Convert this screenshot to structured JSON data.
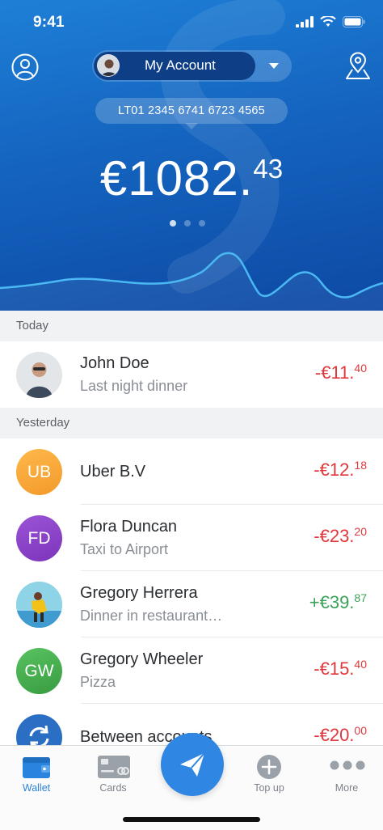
{
  "status_bar": {
    "time": "9:41"
  },
  "header": {
    "account_label": "My Account",
    "iban": "LT01 2345 6741 6723 4565",
    "balance_main": "€1082.",
    "balance_cents": "43"
  },
  "sections": [
    {
      "title": "Today"
    },
    {
      "title": "Yesterday"
    }
  ],
  "transactions": [
    {
      "name": "John Doe",
      "description": "Last night dinner",
      "amount_main": "-€11.",
      "amount_cents": "40",
      "initials": "",
      "avatar": "photo-man-glasses"
    },
    {
      "name": "Uber B.V",
      "description": "",
      "amount_main": "-€12.",
      "amount_cents": "18",
      "initials": "UB",
      "avatar_color": "#f5a33a"
    },
    {
      "name": "Flora Duncan",
      "description": "Taxi to Airport",
      "amount_main": "-€23.",
      "amount_cents": "20",
      "initials": "FD",
      "avatar_color": "#8d3fc9"
    },
    {
      "name": "Gregory Herrera",
      "description": "Dinner in restaurant…",
      "amount_main": "+€39.",
      "amount_cents": "87",
      "initials": "",
      "avatar": "photo-person-yellow"
    },
    {
      "name": "Gregory Wheeler",
      "description": "Pizza",
      "amount_main": "-€15.",
      "amount_cents": "40",
      "initials": "GW",
      "avatar_color": "#43b04a"
    },
    {
      "name": "Between accounts",
      "description": "",
      "amount_main": "-€20.",
      "amount_cents": "00",
      "initials": "",
      "avatar": "refresh-icon",
      "avatar_color": "#2a6fc4"
    }
  ],
  "tabbar": {
    "wallet": "Wallet",
    "cards": "Cards",
    "topup": "Top up",
    "more": "More"
  },
  "colors": {
    "accent": "#2f86e3",
    "negative": "#e0373c",
    "positive": "#3aa15a"
  }
}
